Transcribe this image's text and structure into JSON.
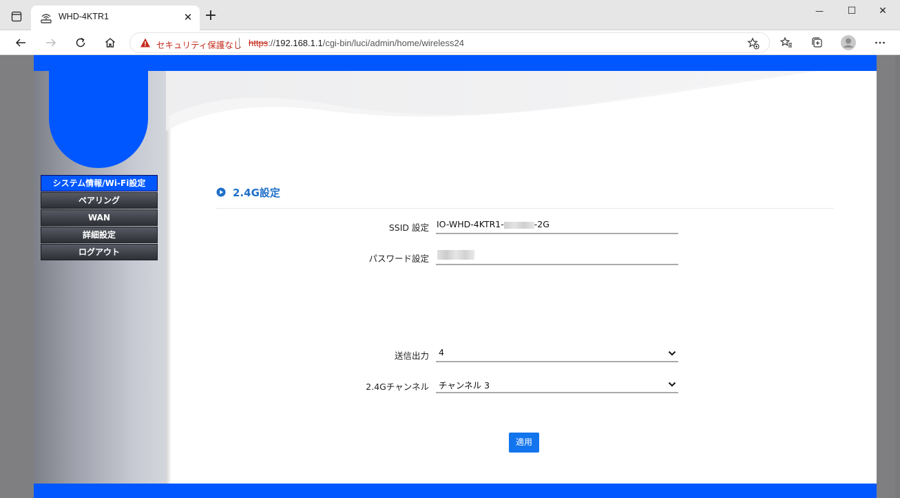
{
  "browser": {
    "tab_title": "WHD-4KTR1",
    "tab_close": "✕",
    "new_tab": "+",
    "minimize": "—",
    "maximize": "☐",
    "close": "✕",
    "security_text": "セキュリティ保護なし",
    "url_scheme": "https",
    "url_sep": "://",
    "url_host": "192.168.1.1",
    "url_path": "/cgi-bin/luci/admin/home/wireless24"
  },
  "sidebar": {
    "items": [
      {
        "label": "システム情報/Wi-Fi設定",
        "active": true
      },
      {
        "label": "ペアリング",
        "active": false
      },
      {
        "label": "WAN",
        "active": false
      },
      {
        "label": "詳細設定",
        "active": false
      },
      {
        "label": "ログアウト",
        "active": false
      }
    ]
  },
  "main": {
    "section_title": "2.4G設定",
    "ssid": {
      "label": "SSID 設定",
      "value_prefix": "IO-WHD-4KTR1-",
      "value_suffix": "-2G"
    },
    "password": {
      "label": "パスワード設定"
    },
    "tx_power": {
      "label": "送信出力",
      "value": "4"
    },
    "channel": {
      "label": "2.4Gチャンネル",
      "value": "チャンネル 3"
    },
    "apply_label": "適用"
  },
  "colors": {
    "brand_blue": "#0057ff",
    "title_blue": "#1f6fc7",
    "button_blue": "#1275ee",
    "warning_red": "#c42b1c"
  }
}
